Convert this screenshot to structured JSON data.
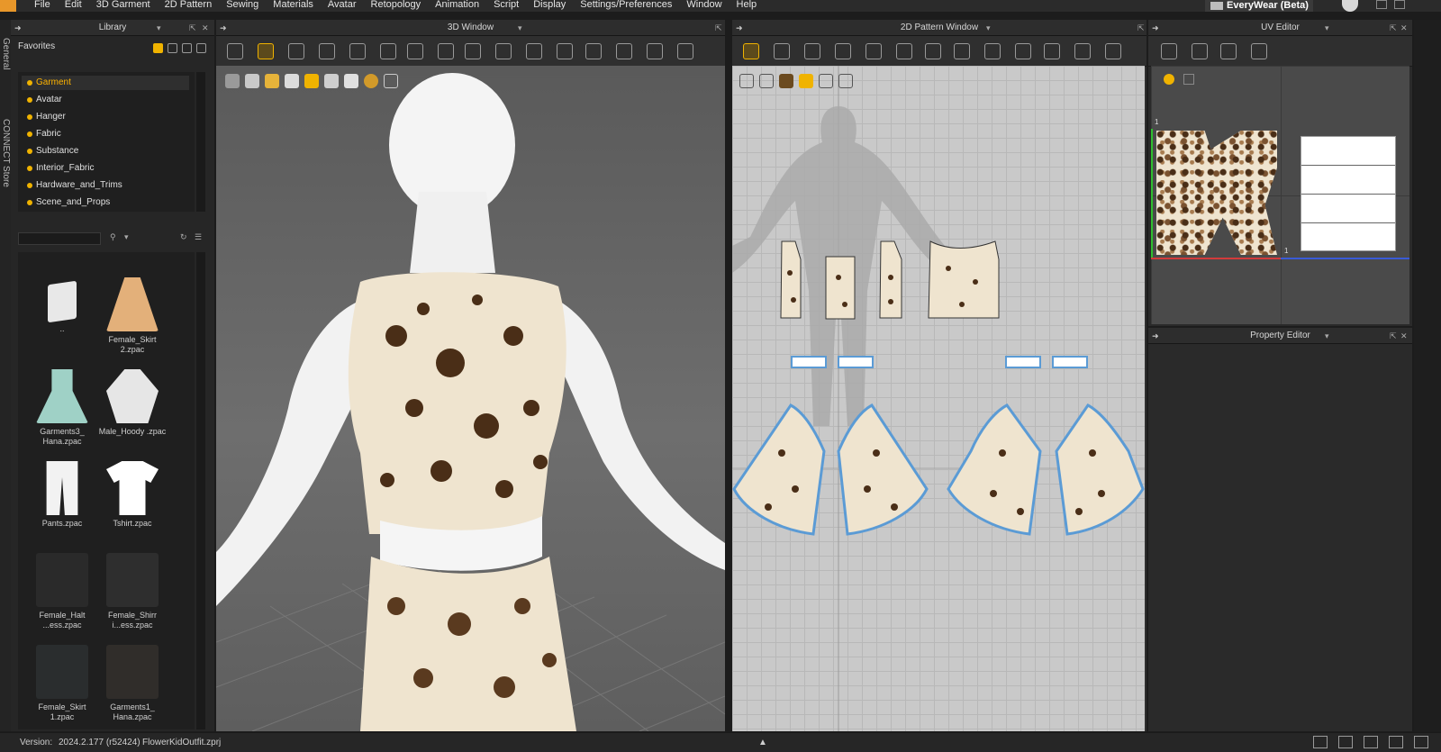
{
  "menubar": {
    "items": [
      "File",
      "Edit",
      "3D Garment",
      "2D Pattern",
      "Sewing",
      "Materials",
      "Avatar",
      "Retopology",
      "Animation",
      "Script",
      "Display",
      "Settings/Preferences",
      "Window",
      "Help"
    ],
    "product": "EveryWear (Beta)"
  },
  "sidetabs": [
    "General",
    "CONNECT Store"
  ],
  "library": {
    "title": "Library",
    "favorites_label": "Favorites",
    "favorites": [
      "Garment",
      "Avatar",
      "Hanger",
      "Fabric",
      "Substance",
      "Interior_Fabric",
      "Hardware_and_Trims",
      "Scene_and_Props"
    ],
    "selected_favorite": "Garment",
    "thumbnails": [
      {
        "label": "..",
        "icon": "folder-icon"
      },
      {
        "label": "Female_Skirt 2.zpac",
        "icon": "skirt-thumb"
      },
      {
        "label": "Garments3_ Hana.zpac",
        "icon": "dress-thumb"
      },
      {
        "label": "Male_Hoody .zpac",
        "icon": "hoody-thumb"
      },
      {
        "label": "Pants.zpac",
        "icon": "pants-thumb"
      },
      {
        "label": "Tshirt.zpac",
        "icon": "tshirt-thumb"
      },
      {
        "label": "Female_Halt ...ess.zpac",
        "icon": "halter-dress-thumb"
      },
      {
        "label": "Female_Shirr i...ess.zpac",
        "icon": "shirred-dress-thumb"
      },
      {
        "label": "Female_Skirt 1.zpac",
        "icon": "skirt-thumb"
      },
      {
        "label": "Garments1_ Hana.zpac",
        "icon": "outfit-thumb"
      }
    ]
  },
  "window3d": {
    "title": "3D Window"
  },
  "window2d": {
    "title": "2D Pattern Window"
  },
  "uv_editor": {
    "title": "UV Editor",
    "marker_1": "1",
    "marker_2": "1"
  },
  "property_editor": {
    "title": "Property Editor"
  },
  "statusbar": {
    "version_label": "Version:",
    "version": "2024.2.177 (r52424)",
    "file": "FlowerKidOutfit.zprj"
  },
  "colors": {
    "accent": "#f0b300",
    "fabric_base": "#efe4cf",
    "fabric_flower": "#4a2e17",
    "pattern_outline": "#5b9bd5",
    "uv_green": "#2fbf2f",
    "uv_red": "#d23b3b",
    "uv_blue": "#3a5bd6"
  }
}
